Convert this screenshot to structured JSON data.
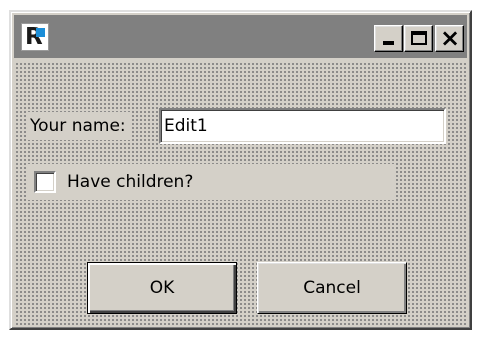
{
  "titlebar": {
    "app_icon": "fr-app-icon",
    "minimize_glyph": "_",
    "maximize_glyph": "□",
    "close_glyph": "×"
  },
  "form": {
    "name_label": "Your name:",
    "name_value": "Edit1",
    "checkbox_label": "Have children?",
    "checkbox_checked": false
  },
  "buttons": {
    "ok_label": "OK",
    "cancel_label": "Cancel"
  },
  "colors": {
    "title_bar": "#808080",
    "window_face": "#d4d0c8",
    "icon_accent": "#1b8ed8"
  }
}
